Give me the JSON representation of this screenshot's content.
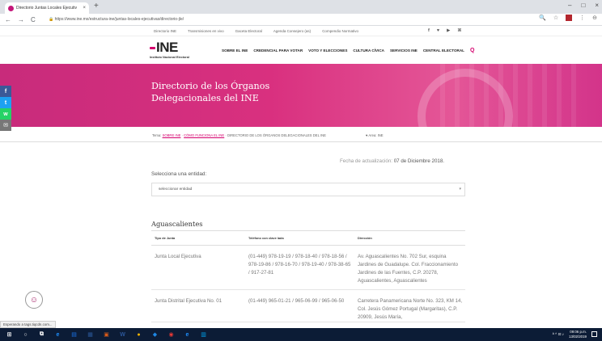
{
  "browser": {
    "tab_title": "Directorio Juntas Locales Ejecutiv",
    "tab_close": "×",
    "new_tab": "+",
    "window_controls": [
      "–",
      "□",
      "×"
    ],
    "nav": [
      "←",
      "→",
      "C"
    ],
    "url": "https://www.ine.mx/estructura-ine/juntas-locales-ejecutivas/directorio-jle/",
    "toolbar_icons": [
      "🔍",
      "☆",
      "⋮",
      "⊖"
    ],
    "status_text": "Esperando a tags.tiqcdn.com..."
  },
  "utility_bar": {
    "links": [
      "Directorio INE",
      "Transmisiones en vivo",
      "Gaceta Electoral",
      "Agenda Consejero (as)",
      "Compendio Normativo"
    ],
    "social": [
      "f",
      "♥",
      "▶",
      "⌘"
    ]
  },
  "header": {
    "logo_mark": "INE",
    "logo_sub": "Instituto Nacional Electoral",
    "menu": [
      "SOBRE EL INE",
      "CREDENCIAL PARA VOTAR",
      "VOTO Y ELECCIONES",
      "CULTURA CÍVICA",
      "SERVICIOS INE",
      "CENTRAL ELECTORAL"
    ],
    "search_icon": "Q"
  },
  "hero": {
    "title_line1": "Directorio de los Órganos",
    "title_line2": "Delegacionales del INE"
  },
  "social_sidebar": [
    "f",
    "t",
    "w",
    "✉"
  ],
  "breadcrumb": {
    "prefix": "Tema: ",
    "link1": "SOBRE INE",
    "sep1": " · ",
    "link2": "CÓMO FUNCIONA EL INE",
    "sep2": " · ",
    "current": "DIRECTORIO DE LOS ÓRGANOS DELEGACIONALES DEL INE",
    "map_label": "♥ Area: INE"
  },
  "update": {
    "label": "Fecha de actualización: ",
    "date": "07 de Diciembre 2018."
  },
  "entity_select": {
    "label": "Selecciona una entidad:",
    "value": "seleccionar entidad",
    "caret": "▾"
  },
  "state_title": "Aguascalientes",
  "table": {
    "headers": [
      "Tipo de Junta",
      "Teléfono con clave lada",
      "Dirección"
    ],
    "rows": [
      {
        "tipo": "Junta Local Ejecutiva",
        "telefono": "(01-449) 978-19-19 / 978-18-40 / 978-18-56 / 978-19-86 / 978-16-70 / 978-19-40 / 978-38-65 / 917-27-81",
        "direccion": "Av. Aguascalientes No. 702 Sur, esquina Jardines de Guadalupe. Col. Fraccionamiento Jardines de las Fuentes, C.P. 20278, Aguascalientes, Aguascalientes"
      },
      {
        "tipo": "Junta Distrital Ejecutiva No. 01",
        "telefono": "(01-449) 965-01-21 / 965-06-99 / 965-06-50",
        "direccion": "Carretera Panamericana Norte No. 323, KM 14, Col. Jesús Gómez Portugal (Margaritas), C.P. 20909, Jesús María,"
      }
    ]
  },
  "feedback_icon": "☺",
  "taskbar": {
    "icons": [
      "⊞",
      "○",
      "⧉",
      "e",
      "▤",
      "▦",
      "▣",
      "W",
      "●",
      "◆",
      "◉",
      "e",
      "▥"
    ],
    "icon_colors": [
      "#ffffff",
      "#ffffff",
      "#ffffff",
      "#1e90ff",
      "#1a73e8",
      "#2b5797",
      "#d65a1a",
      "#2b579a",
      "#f4b400",
      "#1e88e5",
      "#e53935",
      "#1e90ff",
      "#00a4ef"
    ],
    "tray": "ᴬ ^ ⊡ ♪",
    "time": "09:06 p.m.",
    "date": "13/02/2019"
  }
}
